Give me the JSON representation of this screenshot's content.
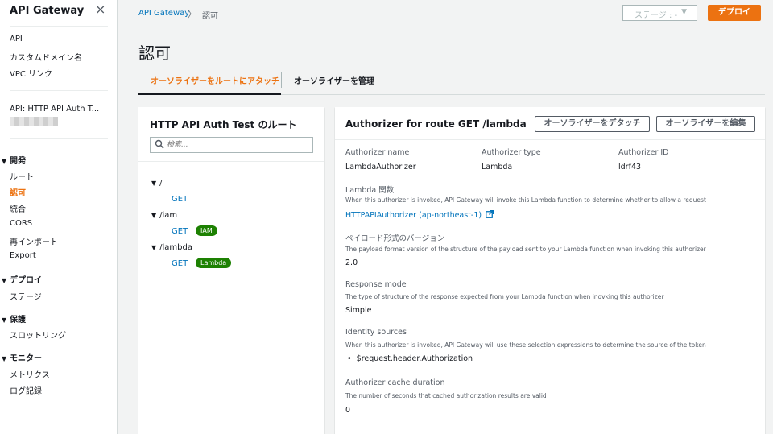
{
  "sidebar": {
    "title": "API Gateway",
    "close_icon": "×",
    "top_links": [
      "API",
      "カスタムドメイン名",
      "VPC リンク"
    ],
    "api_name": "API: HTTP API Auth T...",
    "sections": [
      {
        "title": "開発",
        "items": [
          "ルート",
          "認可",
          "統合",
          "CORS",
          "再インポート",
          "Export"
        ],
        "active_item": "認可"
      },
      {
        "title": "デプロイ",
        "items": [
          "ステージ"
        ]
      },
      {
        "title": "保護",
        "items": [
          "スロットリング"
        ]
      },
      {
        "title": "モニター",
        "items": [
          "メトリクス",
          "ログ記録"
        ]
      }
    ]
  },
  "breadcrumb": {
    "parent": "API Gateway",
    "separator": "〉",
    "current": "認可"
  },
  "header": {
    "stage_select": "ステージ : -",
    "deploy_label": "デプロイ"
  },
  "page_title": "認可",
  "tabs": [
    {
      "label": "オーソライザーをルートにアタッチ",
      "active": true
    },
    {
      "label": "オーソライザーを管理",
      "active": false
    }
  ],
  "routes_panel": {
    "title": "HTTP API Auth Test のルート",
    "search_placeholder": "検索...",
    "routes": [
      {
        "path": "/",
        "methods": [
          {
            "method": "GET",
            "badge": ""
          }
        ]
      },
      {
        "path": "/iam",
        "methods": [
          {
            "method": "GET",
            "badge": "IAM"
          }
        ]
      },
      {
        "path": "/lambda",
        "methods": [
          {
            "method": "GET",
            "badge": "Lambda"
          }
        ]
      }
    ]
  },
  "detail_panel": {
    "title": "Authorizer for route GET /lambda",
    "detach_label": "オーソライザーをデタッチ",
    "edit_label": "オーソライザーを編集",
    "authorizer_name_label": "Authorizer name",
    "authorizer_name": "LambdaAuthorizer",
    "authorizer_type_label": "Authorizer type",
    "authorizer_type": "Lambda",
    "authorizer_id_label": "Authorizer ID",
    "authorizer_id": "ldrf43",
    "lambda_label": "Lambda 関数",
    "lambda_desc": "When this authorizer is invoked, API Gateway will invoke this Lambda function to determine whether to allow a request",
    "lambda_link": "HTTPAPIAuthorizer (ap-northeast-1)",
    "payload_label": "ペイロード形式のバージョン",
    "payload_desc": "The payload format version of the structure of the payload sent to your Lambda function when invoking this authorizer",
    "payload_value": "2.0",
    "response_label": "Response mode",
    "response_desc": "The type of structure of the response expected from your Lambda function when inovking this authorizer",
    "response_value": "Simple",
    "identity_label": "Identity sources",
    "identity_desc": "When this authorizer is invoked, API Gateway will use these selection expressions to determine the source of the token",
    "identity_value": "$request.header.Authorization",
    "cache_label": "Authorizer cache duration",
    "cache_desc": "The number of seconds that cached authorization results are valid",
    "cache_value": "0"
  },
  "colors": {
    "accent": "#ec7211",
    "link": "#0073bb",
    "badge": "#1d8102"
  }
}
